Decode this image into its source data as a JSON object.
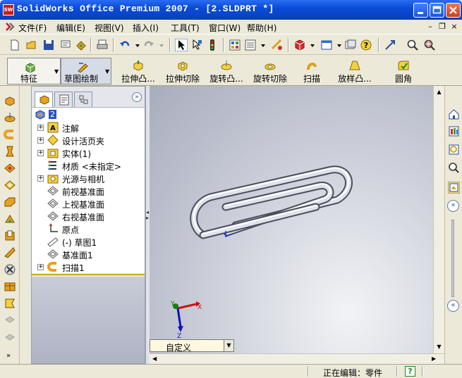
{
  "window": {
    "app_icon_text": "SW",
    "title": "SolidWorks Office Premium 2007 - [2.SLDPRT *]"
  },
  "menu": [
    "文件(F)",
    "编辑(E)",
    "视图(V)",
    "插入(I)",
    "工具(T)",
    "窗口(W)",
    "帮助(H)"
  ],
  "command_manager": {
    "tabs": [
      "特征",
      "草图绘制"
    ],
    "buttons": [
      "拉伸凸...",
      "拉伸切除",
      "旋转凸...",
      "旋转切除",
      "扫描",
      "放样凸...",
      "圆角"
    ]
  },
  "feature_tree": {
    "root": "2",
    "items": [
      {
        "label": "注解",
        "expandable": true,
        "icon": "annotations-icon"
      },
      {
        "label": "设计活页夹",
        "expandable": true,
        "icon": "design-binder-icon"
      },
      {
        "label": "实体(1)",
        "expandable": true,
        "icon": "solid-bodies-icon"
      },
      {
        "label": "材质 <未指定>",
        "expandable": false,
        "icon": "material-icon"
      },
      {
        "label": "光源与相机",
        "expandable": true,
        "icon": "lights-cameras-icon"
      },
      {
        "label": "前视基准面",
        "expandable": false,
        "icon": "plane-icon"
      },
      {
        "label": "上视基准面",
        "expandable": false,
        "icon": "plane-icon"
      },
      {
        "label": "右视基准面",
        "expandable": false,
        "icon": "plane-icon"
      },
      {
        "label": "原点",
        "expandable": false,
        "icon": "origin-icon"
      },
      {
        "label": "(-) 草图1",
        "expandable": false,
        "icon": "sketch-icon"
      },
      {
        "label": "基准面1",
        "expandable": false,
        "icon": "plane-icon"
      },
      {
        "label": "扫描1",
        "expandable": true,
        "icon": "sweep-icon"
      }
    ]
  },
  "viewport": {
    "view_orientation": "自定义",
    "triad_labels": {
      "x": "X",
      "y": "Y",
      "z": "Z"
    }
  },
  "status": {
    "text": "正在编辑：零件",
    "help": "?"
  },
  "colors": {
    "titlebar": "#0a4bd8",
    "accent_selection": "#e6d34a",
    "triad_x": "#d01010",
    "triad_y": "#108010",
    "triad_z": "#1010c0"
  }
}
